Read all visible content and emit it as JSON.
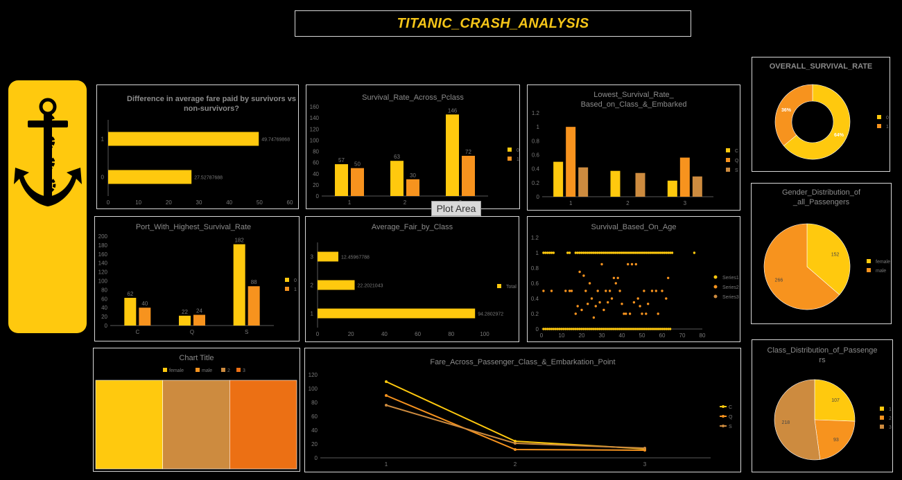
{
  "header": {
    "title": "TITANIC_CRASH_ANALYSIS"
  },
  "logo": {
    "icon": "anchor-icon",
    "background": "#ffc90e"
  },
  "colors": {
    "gold": "#ffc90e",
    "orange": "#f7931e",
    "tan": "#cd8b3f",
    "darkorange": "#ec7014"
  },
  "tooltip": {
    "text": "Plot Area"
  },
  "chart_data": [
    {
      "id": "fare_diff",
      "type": "bar",
      "orientation": "horizontal",
      "title": "Difference in average fare paid by survivors vs non-survivors?",
      "categories": [
        "0",
        "1"
      ],
      "values": [
        27.52787688,
        49.74769868
      ],
      "value_labels": [
        "27.52787688",
        "49.74769868"
      ],
      "xlim": [
        0,
        60
      ],
      "xticks": [
        0,
        10,
        20,
        30,
        40,
        50,
        60
      ],
      "grid": false
    },
    {
      "id": "survival_pclass",
      "type": "bar",
      "title": "Survival_Rate_Across_Pclass",
      "categories": [
        "1",
        "2",
        "3"
      ],
      "series": [
        {
          "name": "0",
          "values": [
            57,
            63,
            146
          ]
        },
        {
          "name": "1",
          "values": [
            50,
            30,
            72
          ]
        }
      ],
      "ylim": [
        0,
        160
      ],
      "yticks": [
        0,
        20,
        40,
        60,
        80,
        100,
        120,
        140,
        160
      ],
      "legend": "right",
      "grid": false
    },
    {
      "id": "lowest_survival",
      "type": "bar",
      "title": "Lowest_Survival_Rate_ Based_on_Class_&_Embarked",
      "categories": [
        "1",
        "2",
        "3"
      ],
      "series": [
        {
          "name": "C",
          "values": [
            0.5,
            0.37,
            0.23
          ]
        },
        {
          "name": "Q",
          "values": [
            1,
            null,
            0.56
          ]
        },
        {
          "name": "S",
          "values": [
            0.42,
            0.34,
            0.29
          ]
        }
      ],
      "ylim": [
        0,
        1.2
      ],
      "yticks": [
        "0",
        "0.2",
        "0.4",
        "0.6",
        "0.8",
        "1",
        "1.2"
      ],
      "legend": "right",
      "grid": false
    },
    {
      "id": "overall_survival",
      "type": "pie",
      "subtype": "donut",
      "title": "OVERALL_SURVIVAL_RATE",
      "labels": [
        "0",
        "1"
      ],
      "values": [
        64,
        36
      ],
      "value_labels": [
        "64%",
        "36%"
      ],
      "legend": "right"
    },
    {
      "id": "port_survival",
      "type": "bar",
      "title": "Port_With_Highest_Survival_Rate",
      "categories": [
        "C",
        "Q",
        "S"
      ],
      "series": [
        {
          "name": "0",
          "values": [
            62,
            22,
            182
          ]
        },
        {
          "name": "1",
          "values": [
            40,
            24,
            88
          ]
        }
      ],
      "ylim": [
        0,
        200
      ],
      "yticks": [
        0,
        20,
        40,
        60,
        80,
        100,
        120,
        140,
        160,
        180,
        200
      ],
      "legend": "right",
      "grid": false
    },
    {
      "id": "avg_fare_class",
      "type": "bar",
      "orientation": "horizontal",
      "title": "Average_Fair_by_Class",
      "categories": [
        "1",
        "2",
        "3"
      ],
      "series": [
        {
          "name": "Total",
          "values": [
            94.2802972,
            22.2021043,
            12.45967788
          ]
        }
      ],
      "value_labels": [
        "94.2802972",
        "22.2021043",
        "12.45967788"
      ],
      "xlim": [
        0,
        100
      ],
      "xticks": [
        0,
        20,
        40,
        60,
        80,
        100
      ],
      "legend": "right",
      "grid": false
    },
    {
      "id": "survival_age",
      "type": "scatter",
      "title": "Survival_Based_On_Age",
      "series": [
        {
          "name": "Series1",
          "points": [
            [
              1,
              1
            ],
            [
              2,
              1
            ],
            [
              3,
              1
            ],
            [
              4,
              1
            ],
            [
              5,
              1
            ],
            [
              6,
              1
            ],
            [
              13,
              1
            ],
            [
              14,
              1
            ],
            [
              17,
              1
            ],
            [
              18,
              1
            ],
            [
              19,
              1
            ],
            [
              20,
              1
            ],
            [
              21,
              1
            ],
            [
              22,
              1
            ],
            [
              23,
              1
            ],
            [
              24,
              1
            ],
            [
              25,
              1
            ],
            [
              26,
              1
            ],
            [
              27,
              1
            ],
            [
              28,
              1
            ],
            [
              29,
              1
            ],
            [
              30,
              1
            ],
            [
              31,
              1
            ],
            [
              32,
              1
            ],
            [
              33,
              1
            ],
            [
              34,
              1
            ],
            [
              35,
              1
            ],
            [
              36,
              1
            ],
            [
              37,
              1
            ],
            [
              38,
              1
            ],
            [
              39,
              1
            ],
            [
              40,
              1
            ],
            [
              41,
              1
            ],
            [
              42,
              1
            ],
            [
              43,
              1
            ],
            [
              44,
              1
            ],
            [
              45,
              1
            ],
            [
              46,
              1
            ],
            [
              47,
              1
            ],
            [
              48,
              1
            ],
            [
              49,
              1
            ],
            [
              50,
              1
            ],
            [
              51,
              1
            ],
            [
              52,
              1
            ],
            [
              53,
              1
            ],
            [
              54,
              1
            ],
            [
              55,
              1
            ],
            [
              56,
              1
            ],
            [
              57,
              1
            ],
            [
              58,
              1
            ],
            [
              59,
              1
            ],
            [
              60,
              1
            ],
            [
              61,
              1
            ],
            [
              62,
              1
            ],
            [
              63,
              1
            ],
            [
              64,
              1
            ],
            [
              65,
              1
            ],
            [
              76,
              1
            ],
            [
              1,
              0
            ],
            [
              2,
              0
            ],
            [
              3,
              0
            ],
            [
              4,
              0
            ],
            [
              5,
              0
            ],
            [
              6,
              0
            ],
            [
              7,
              0
            ],
            [
              8,
              0
            ],
            [
              9,
              0
            ],
            [
              10,
              0
            ],
            [
              11,
              0
            ],
            [
              12,
              0
            ],
            [
              13,
              0
            ],
            [
              14,
              0
            ],
            [
              15,
              0
            ],
            [
              16,
              0
            ],
            [
              17,
              0
            ],
            [
              18,
              0
            ],
            [
              19,
              0
            ],
            [
              20,
              0
            ],
            [
              21,
              0
            ],
            [
              22,
              0
            ],
            [
              23,
              0
            ],
            [
              24,
              0
            ],
            [
              25,
              0
            ],
            [
              26,
              0
            ],
            [
              27,
              0
            ],
            [
              28,
              0
            ],
            [
              29,
              0
            ],
            [
              30,
              0
            ],
            [
              31,
              0
            ],
            [
              32,
              0
            ],
            [
              33,
              0
            ],
            [
              34,
              0
            ],
            [
              35,
              0
            ],
            [
              36,
              0
            ],
            [
              37,
              0
            ],
            [
              38,
              0
            ],
            [
              39,
              0
            ],
            [
              40,
              0
            ],
            [
              41,
              0
            ],
            [
              42,
              0
            ],
            [
              43,
              0
            ],
            [
              44,
              0
            ],
            [
              45,
              0
            ],
            [
              46,
              0
            ],
            [
              47,
              0
            ],
            [
              48,
              0
            ],
            [
              49,
              0
            ],
            [
              50,
              0
            ],
            [
              51,
              0
            ],
            [
              52,
              0
            ],
            [
              53,
              0
            ],
            [
              54,
              0
            ],
            [
              55,
              0
            ],
            [
              56,
              0
            ],
            [
              57,
              0
            ],
            [
              58,
              0
            ],
            [
              59,
              0
            ],
            [
              60,
              0
            ],
            [
              61,
              0
            ],
            [
              62,
              0
            ],
            [
              63,
              0
            ],
            [
              64,
              0
            ]
          ]
        },
        {
          "name": "Series2",
          "points": [
            [
              1,
              0.5
            ],
            [
              5,
              0.5
            ],
            [
              12,
              0.5
            ],
            [
              14,
              0.5
            ],
            [
              15,
              0.5
            ],
            [
              17,
              0.2
            ],
            [
              18,
              0.3
            ],
            [
              19,
              0.75
            ],
            [
              20,
              0.25
            ],
            [
              21,
              0.7
            ],
            [
              22,
              0.5
            ],
            [
              23,
              0.33
            ],
            [
              24,
              0.6
            ],
            [
              25,
              0.4
            ],
            [
              26,
              0.15
            ],
            [
              27,
              0.3
            ],
            [
              28,
              0.5
            ],
            [
              29,
              0.35
            ],
            [
              30,
              0.85
            ],
            [
              31,
              0.25
            ],
            [
              32,
              0.5
            ],
            [
              33,
              0.35
            ],
            [
              34,
              0.5
            ],
            [
              35,
              0.4
            ],
            [
              36,
              0.67
            ],
            [
              37,
              0.6
            ],
            [
              38,
              0.67
            ],
            [
              39,
              0.5
            ],
            [
              40,
              0.33
            ],
            [
              41,
              0.2
            ],
            [
              42,
              0.2
            ],
            [
              43,
              0.85
            ],
            [
              44,
              0.2
            ],
            [
              45,
              0.85
            ],
            [
              46,
              0.35
            ],
            [
              47,
              0.85
            ],
            [
              48,
              0.4
            ],
            [
              49,
              0.3
            ],
            [
              50,
              0.2
            ],
            [
              51,
              0.5
            ],
            [
              52,
              0.2
            ],
            [
              53,
              0.33
            ],
            [
              55,
              0.5
            ],
            [
              57,
              0.5
            ],
            [
              58,
              0.2
            ],
            [
              60,
              0.5
            ],
            [
              62,
              0.4
            ],
            [
              63,
              0.67
            ]
          ]
        },
        {
          "name": "Series3",
          "points": []
        }
      ],
      "xlim": [
        0,
        80
      ],
      "xticks": [
        0,
        10,
        20,
        30,
        40,
        50,
        60,
        70,
        80
      ],
      "ylim": [
        0,
        1.2
      ],
      "yticks": [
        "0",
        "0.2",
        "0.4",
        "0.6",
        "0.8",
        "1",
        "1.2"
      ],
      "legend": "right",
      "grid": false
    },
    {
      "id": "gender_dist",
      "type": "pie",
      "title": "Gender_Distribution_of _all_Passengers",
      "labels": [
        "female",
        "male"
      ],
      "values": [
        152,
        266
      ],
      "value_labels": [
        "152",
        "266"
      ],
      "legend": "right"
    },
    {
      "id": "chart_title",
      "type": "bar",
      "subtype": "stacked-100",
      "title": "Chart Title",
      "legend_labels": [
        "female",
        "male",
        "2",
        "3"
      ],
      "segments": [
        {
          "name": "female",
          "value": 1
        },
        {
          "name": "2",
          "value": 1
        },
        {
          "name": "3",
          "value": 1
        }
      ],
      "legend": "top"
    },
    {
      "id": "fare_class_embark",
      "type": "line",
      "title": "Fare_Across_Passenger_Class_&_Embarkation_Point",
      "x": [
        "1",
        "2",
        "3"
      ],
      "series": [
        {
          "name": "C",
          "values": [
            110,
            24,
            13
          ]
        },
        {
          "name": "Q",
          "values": [
            90,
            12,
            11
          ]
        },
        {
          "name": "S",
          "values": [
            76,
            21,
            14
          ]
        }
      ],
      "ylim": [
        0,
        120
      ],
      "yticks": [
        0,
        20,
        40,
        60,
        80,
        100,
        120
      ],
      "legend": "right",
      "grid": false
    },
    {
      "id": "class_dist",
      "type": "pie",
      "title": "Class_Distribution_of_Passengers",
      "labels": [
        "1",
        "2",
        "3"
      ],
      "values": [
        107,
        93,
        218
      ],
      "value_labels": [
        "107",
        "93",
        "218"
      ],
      "legend": "right"
    }
  ]
}
